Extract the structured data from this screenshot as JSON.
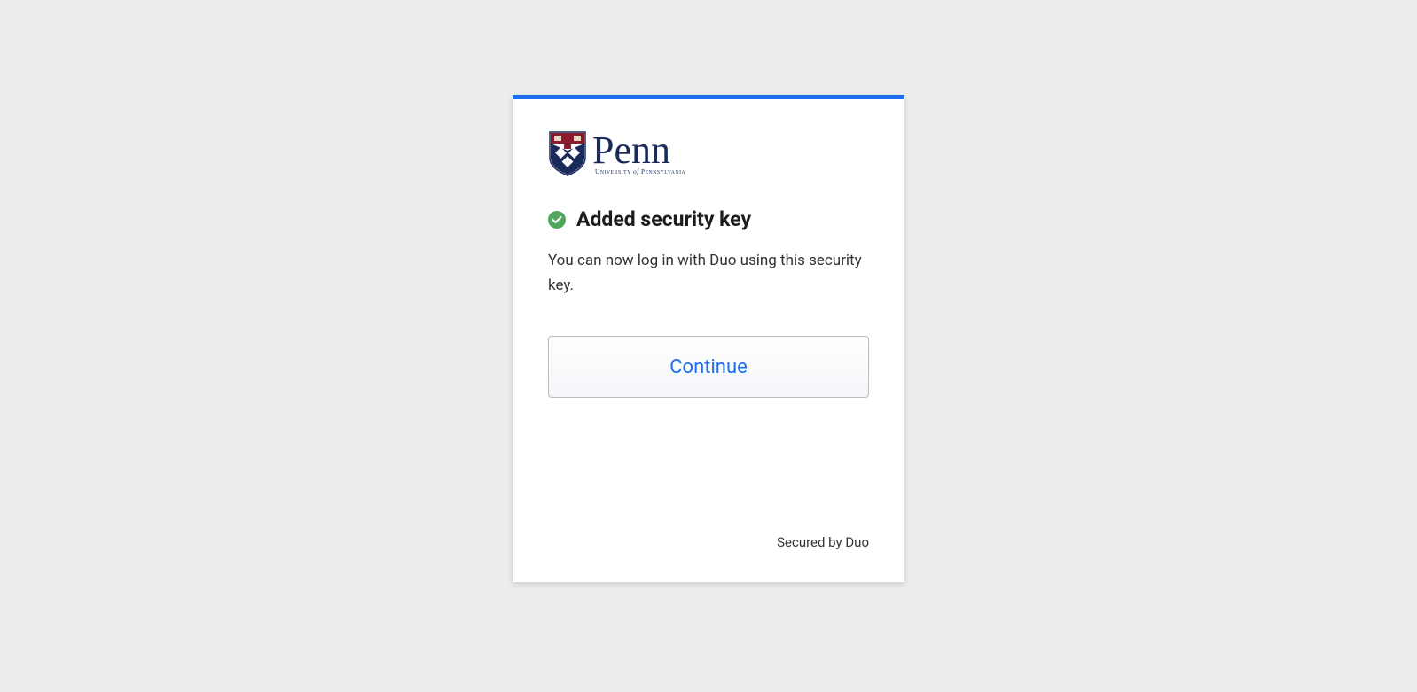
{
  "logo": {
    "org_name": "Penn",
    "org_subtitle": "University of Pennsylvania"
  },
  "heading": "Added security key",
  "description": "You can now log in with Duo using this security key.",
  "continue_label": "Continue",
  "footer_text": "Secured by Duo"
}
